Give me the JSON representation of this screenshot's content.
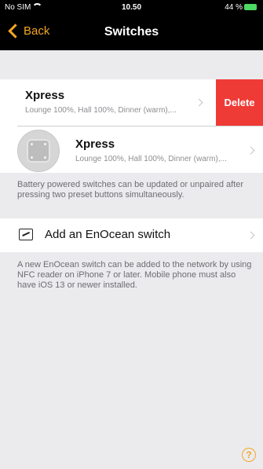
{
  "status": {
    "carrier": "No SIM",
    "time": "10.50",
    "battery": "44 %"
  },
  "nav": {
    "back_label": "Back",
    "title": "Switches"
  },
  "switches": [
    {
      "name": "Xpress",
      "detail": "Lounge 100%, Hall 100%, Dinner (warm),..."
    },
    {
      "name": "Xpress",
      "detail": "Lounge 100%, Hall 100%, Dinner (warm),..."
    }
  ],
  "delete_label": "Delete",
  "battery_note": "Battery powered switches can be updated or unpaired after pressing two preset buttons simultaneously.",
  "add_switch_label": "Add an EnOcean switch",
  "add_note": "A new EnOcean switch can be added to the network by using NFC reader on iPhone 7 or later. Mobile phone must also have iOS 13 or newer installed.",
  "help_symbol": "?",
  "colors": {
    "accent": "#f5a623",
    "delete": "#ef3b36",
    "background": "#ebebee"
  }
}
